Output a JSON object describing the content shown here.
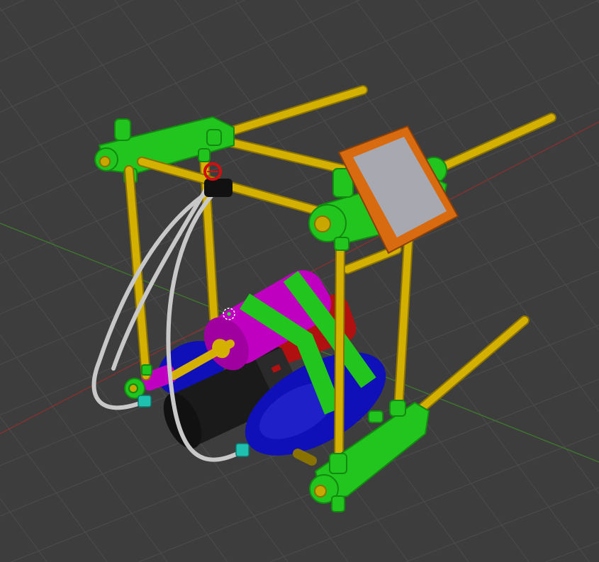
{
  "viewport": {
    "view": "3D viewport",
    "colors": {
      "background": "#3d3d3d",
      "grid": "#4a4a4a",
      "x_axis": "#8a3030",
      "y_axis": "#3e7a2e",
      "rod": "#d4b000",
      "rod_dark": "#8a7200",
      "connector": "#22c41e",
      "connector_dark": "#128a10",
      "tank_magenta": "#c000c0",
      "tank_blue": "#1010b8",
      "tank_black": "#1a1a1a",
      "tank_red": "#b01010",
      "hose": "#c8c8c8",
      "fitting": "#20c0b0",
      "monitor_frame": "#d86a10",
      "monitor_screen": "#a8a8b0",
      "valve": "#d01010"
    },
    "icons": [
      "origin-marker-icon"
    ]
  }
}
